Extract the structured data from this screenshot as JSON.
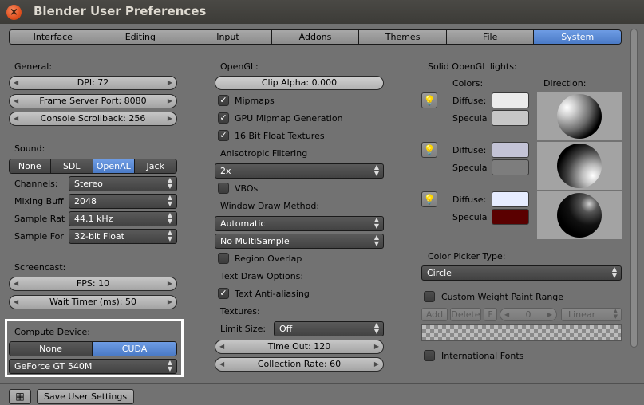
{
  "window": {
    "title": "Blender User Preferences",
    "close_glyph": "×"
  },
  "tabs": [
    "Interface",
    "Editing",
    "Input",
    "Addons",
    "Themes",
    "File",
    "System"
  ],
  "active_tab": "System",
  "general": {
    "header": "General:",
    "dpi": "DPI: 72",
    "frame_server_port": "Frame Server Port: 8080",
    "console_scrollback": "Console Scrollback: 256"
  },
  "sound": {
    "header": "Sound:",
    "devices": [
      "None",
      "SDL",
      "OpenAL",
      "Jack"
    ],
    "selected_device": "OpenAL",
    "channels_label": "Channels:",
    "channels_value": "Stereo",
    "mixing_label": "Mixing Buff",
    "mixing_value": "2048",
    "sample_rate_label": "Sample Rat",
    "sample_rate_value": "44.1 kHz",
    "sample_format_label": "Sample For",
    "sample_format_value": "32-bit Float"
  },
  "screencast": {
    "header": "Screencast:",
    "fps": "FPS: 10",
    "wait_timer": "Wait Timer (ms): 50"
  },
  "compute": {
    "header": "Compute Device:",
    "options": [
      "None",
      "CUDA"
    ],
    "selected": "CUDA",
    "device": "GeForce GT 540M"
  },
  "opengl": {
    "header": "OpenGL:",
    "clip_alpha": "Clip Alpha: 0.000",
    "mipmaps": "Mipmaps",
    "gpu_mipmap": "GPU Mipmap Generation",
    "float_textures": "16 Bit Float Textures",
    "aniso_label": "Anisotropic Filtering",
    "aniso_value": "2x",
    "vbos": "VBOs",
    "window_draw_label": "Window Draw Method:",
    "window_draw_value": "Automatic",
    "multisample_value": "No MultiSample",
    "region_overlap": "Region Overlap",
    "text_draw_label": "Text Draw Options:",
    "text_aa": "Text Anti-aliasing",
    "textures_label": "Textures:",
    "limit_size_label": "Limit Size:",
    "limit_size_value": "Off",
    "time_out": "Time Out: 120",
    "collection_rate": "Collection Rate: 60"
  },
  "lights": {
    "header": "Solid OpenGL lights:",
    "colors_label": "Colors:",
    "direction_label": "Direction:",
    "diffuse_label": "Diffuse:",
    "specular_label": "Specula",
    "rows": [
      {
        "diffuse": "#ececec",
        "specular": "#c7c7c7"
      },
      {
        "diffuse": "#c3c3d6",
        "specular": "#7d7d7d"
      },
      {
        "diffuse": "#e6ecff",
        "specular": "#5a0000"
      }
    ]
  },
  "color_picker": {
    "label": "Color Picker Type:",
    "value": "Circle"
  },
  "weight_paint": {
    "label": "Custom Weight Paint Range",
    "add": "Add",
    "delete": "Delete",
    "f": "F",
    "index": "0",
    "interpolation": "Linear"
  },
  "international_fonts": "International Fonts",
  "footer": {
    "save": "Save User Settings"
  }
}
